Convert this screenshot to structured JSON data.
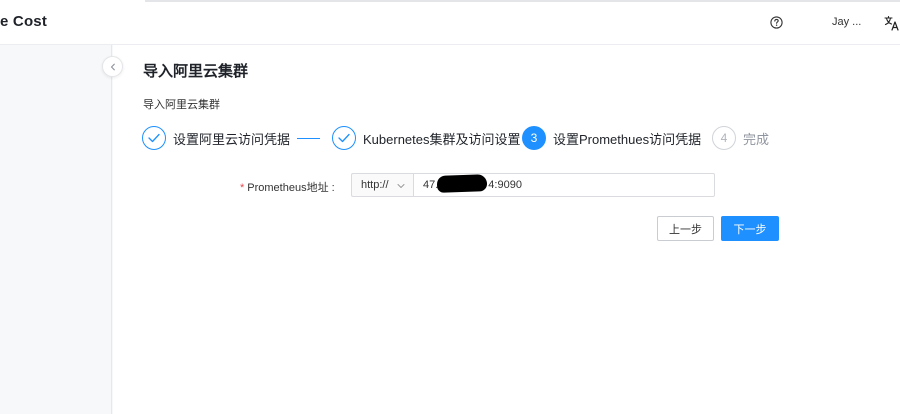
{
  "header": {
    "app_title": "e Cost",
    "user_name": "Jay ...",
    "help_icon": "question-circle-icon",
    "language_icon": "translate-icon"
  },
  "sidebar": {
    "collapse_icon": "chevron-left-icon"
  },
  "page": {
    "title": "导入阿里云集群",
    "breadcrumb": "导入阿里云集群"
  },
  "steps": [
    {
      "number": "1",
      "label": "设置阿里云访问凭据",
      "status": "done"
    },
    {
      "number": "2",
      "label": "Kubernetes集群及访问设置",
      "status": "done"
    },
    {
      "number": "3",
      "label": "设置Promethues访问凭据",
      "status": "active"
    },
    {
      "number": "4",
      "label": "完成",
      "status": "todo"
    }
  ],
  "form": {
    "required_mark": "*",
    "prometheus_label": "Prometheus地址 :",
    "protocol_value": "http://",
    "address_prefix": "47.",
    "address_suffix": "4:9090"
  },
  "buttons": {
    "prev_label": "上一步",
    "next_label": "下一步"
  },
  "colors": {
    "accent": "#1e90ff",
    "required": "#e5484d",
    "todo": "#b0b4ba"
  }
}
